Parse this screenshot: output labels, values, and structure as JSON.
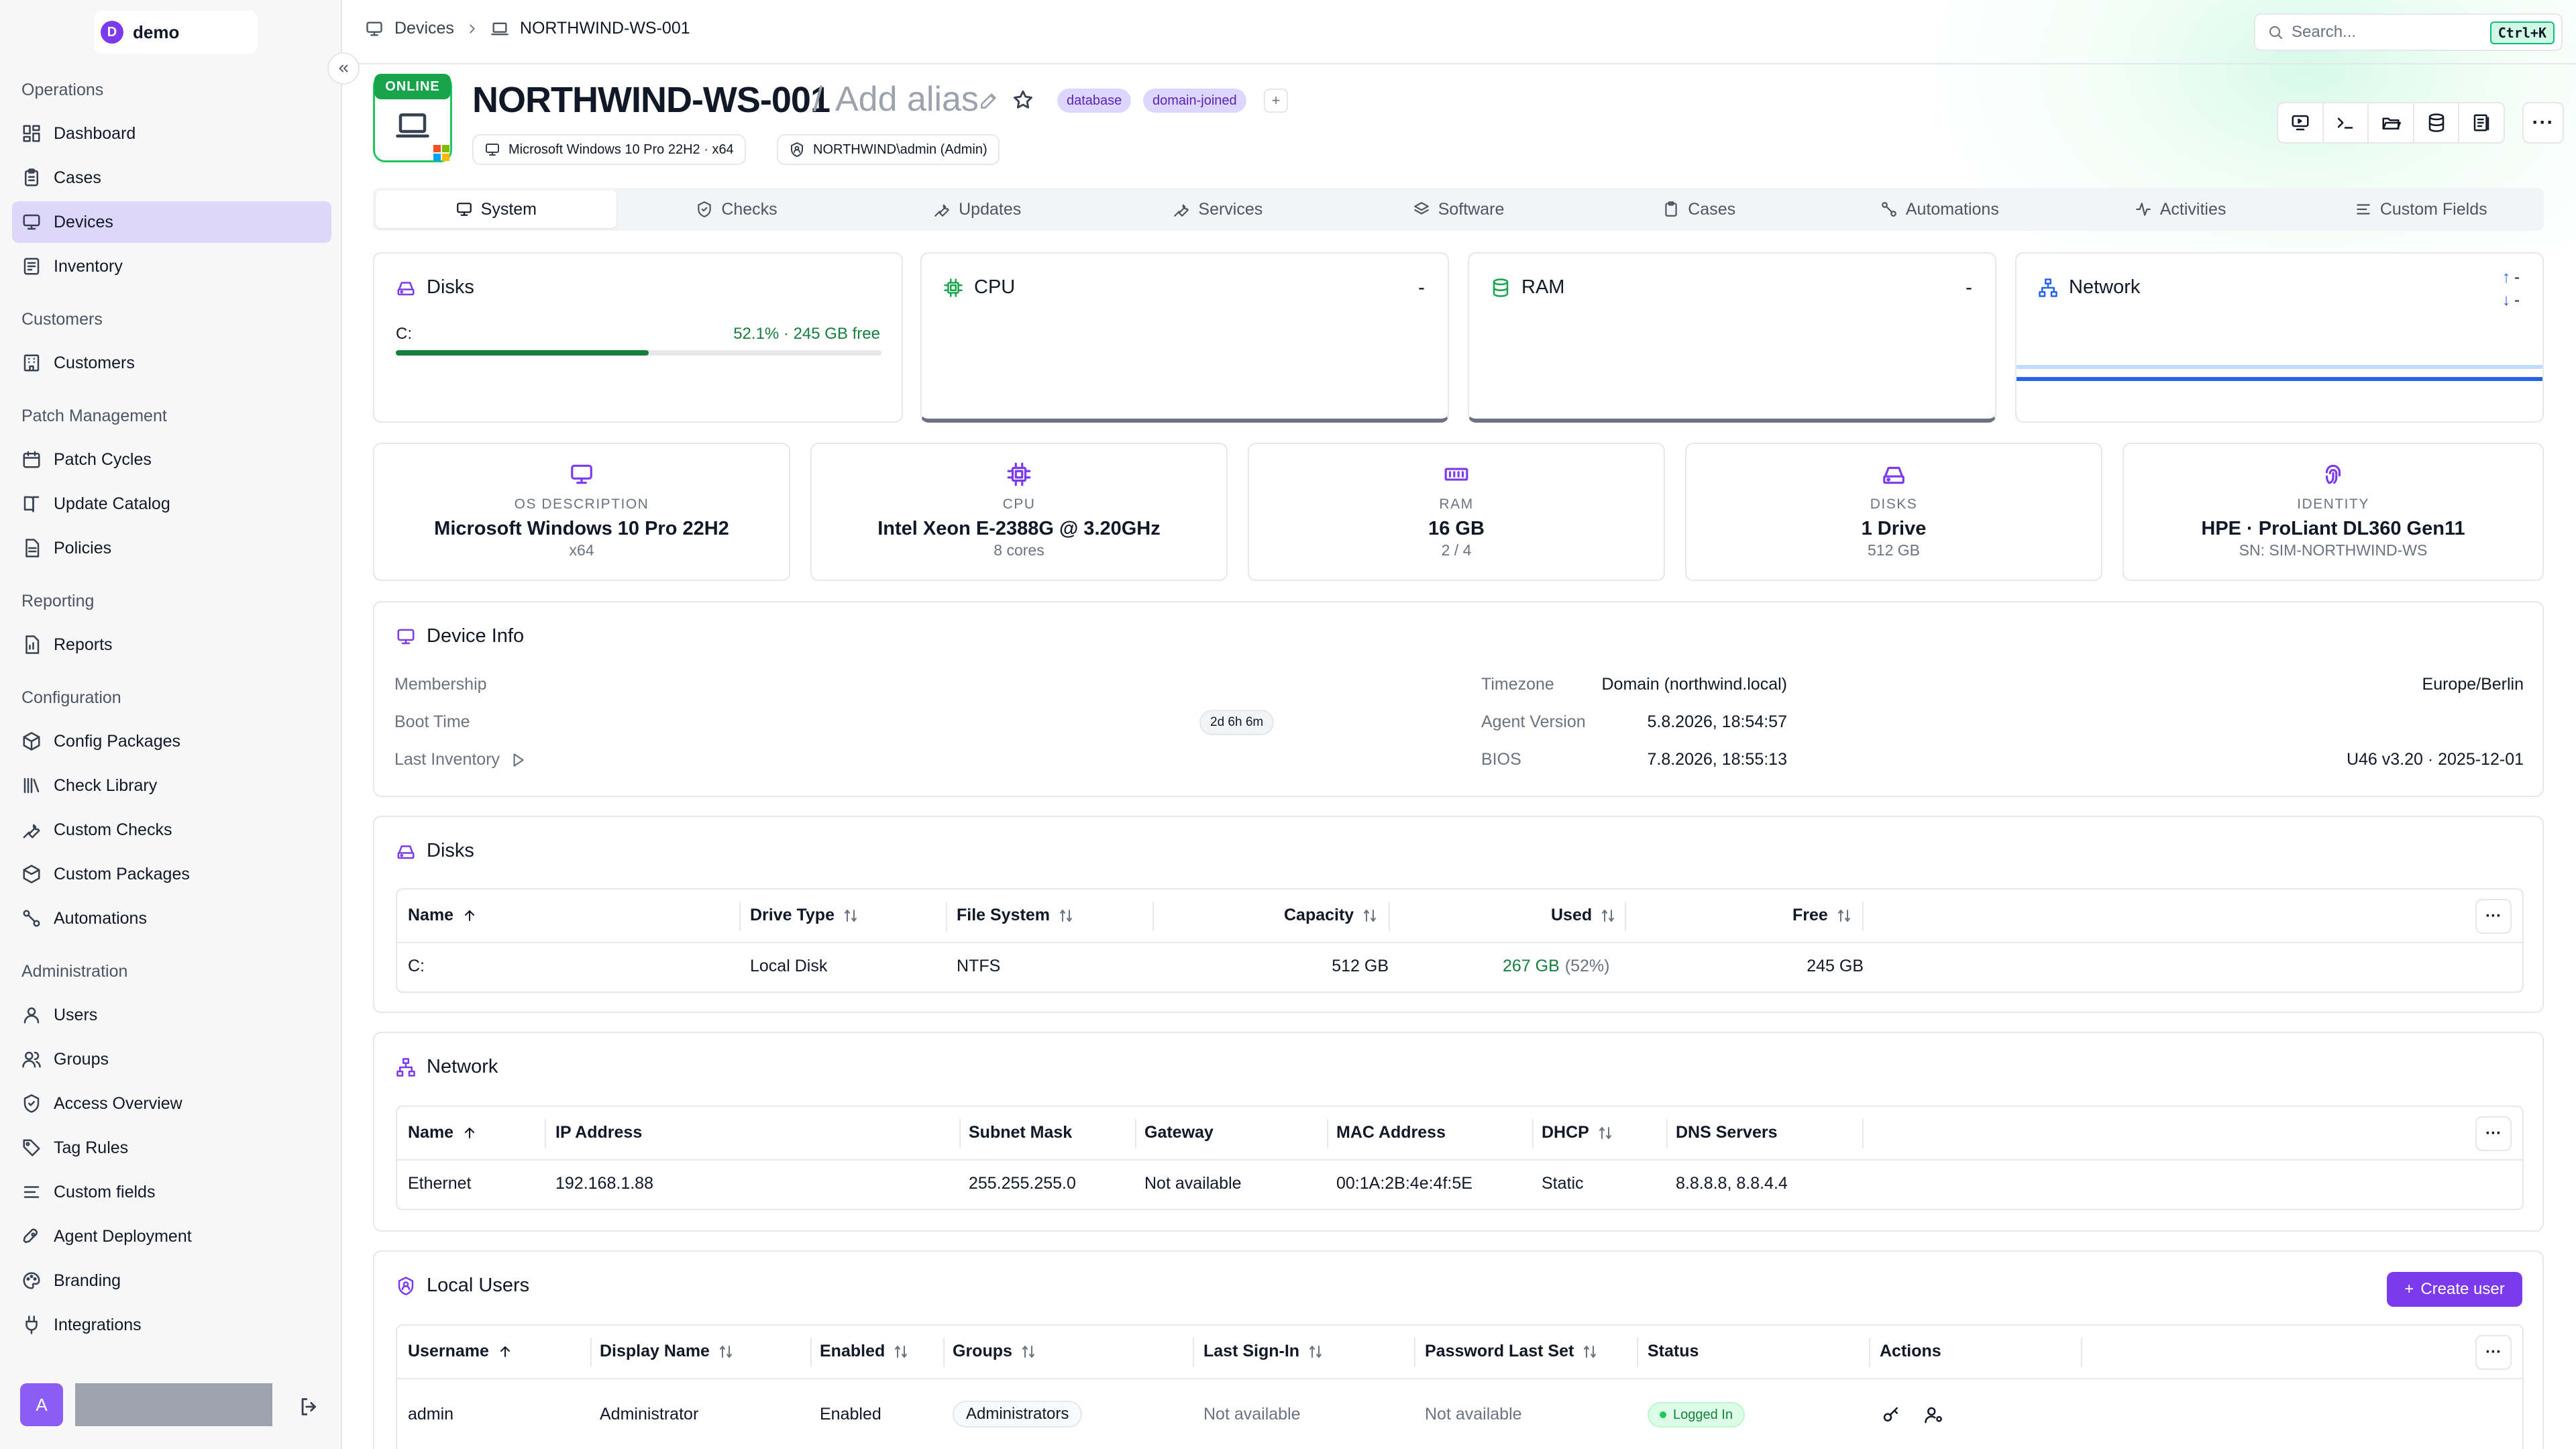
{
  "brand": {
    "initial": "D",
    "name": "demo"
  },
  "sidebar": {
    "sections": [
      {
        "label": "Operations",
        "items": [
          {
            "label": "Dashboard",
            "icon": "dashboard-icon"
          },
          {
            "label": "Cases",
            "icon": "clipboard-icon"
          },
          {
            "label": "Devices",
            "icon": "monitor-icon",
            "active": true
          },
          {
            "label": "Inventory",
            "icon": "inventory-icon"
          }
        ]
      },
      {
        "label": "Customers",
        "items": [
          {
            "label": "Customers",
            "icon": "building-icon"
          }
        ]
      },
      {
        "label": "Patch Management",
        "items": [
          {
            "label": "Patch Cycles",
            "icon": "calendar-icon"
          },
          {
            "label": "Update Catalog",
            "icon": "book-icon"
          },
          {
            "label": "Policies",
            "icon": "document-icon"
          }
        ]
      },
      {
        "label": "Reporting",
        "items": [
          {
            "label": "Reports",
            "icon": "file-chart-icon"
          }
        ]
      },
      {
        "label": "Configuration",
        "items": [
          {
            "label": "Config Packages",
            "icon": "package-icon"
          },
          {
            "label": "Check Library",
            "icon": "library-icon"
          },
          {
            "label": "Custom Checks",
            "icon": "wrench-icon"
          },
          {
            "label": "Custom Packages",
            "icon": "boxes-icon"
          },
          {
            "label": "Automations",
            "icon": "workflow-icon"
          }
        ]
      },
      {
        "label": "Administration",
        "items": [
          {
            "label": "Users",
            "icon": "user-icon"
          },
          {
            "label": "Groups",
            "icon": "users-icon"
          },
          {
            "label": "Access Overview",
            "icon": "shield-icon"
          },
          {
            "label": "Tag Rules",
            "icon": "tag-icon"
          },
          {
            "label": "Custom fields",
            "icon": "list-icon"
          },
          {
            "label": "Agent Deployment",
            "icon": "rocket-icon"
          },
          {
            "label": "Branding",
            "icon": "palette-icon"
          },
          {
            "label": "Integrations",
            "icon": "plug-icon"
          }
        ]
      }
    ],
    "user_initial": "A"
  },
  "breadcrumb": {
    "root": "Devices",
    "current": "NORTHWIND-WS-001"
  },
  "search": {
    "placeholder": "Search...",
    "shortcut": "Ctrl+K"
  },
  "device": {
    "status": "ONLINE",
    "name": "NORTHWIND-WS-001",
    "alias_sep": "/",
    "alias_placeholder": "Add alias",
    "tags": [
      "database",
      "domain-joined"
    ],
    "tag_add": "+",
    "os_chip": "Microsoft Windows 10 Pro 22H2 · x64",
    "user_chip": "NORTHWIND\\admin (Admin)"
  },
  "actions": [
    "remote-desktop-icon",
    "terminal-icon",
    "folder-open-icon",
    "database-icon",
    "registry-icon"
  ],
  "more": "···",
  "tabs": [
    {
      "label": "System",
      "icon": "monitor-icon",
      "active": true
    },
    {
      "label": "Checks",
      "icon": "check-circle-icon"
    },
    {
      "label": "Updates",
      "icon": "wrench-icon"
    },
    {
      "label": "Services",
      "icon": "wrench-icon"
    },
    {
      "label": "Software",
      "icon": "layers-icon"
    },
    {
      "label": "Cases",
      "icon": "clipboard-icon"
    },
    {
      "label": "Automations",
      "icon": "workflow-icon"
    },
    {
      "label": "Activities",
      "icon": "activity-icon"
    },
    {
      "label": "Custom Fields",
      "icon": "list-icon"
    }
  ],
  "metrics": {
    "disks": {
      "title": "Disks",
      "drive": "C:",
      "usage_text": "52.1% · 245 GB free",
      "used_fraction": 0.521
    },
    "cpu": {
      "title": "CPU",
      "value": "-"
    },
    "ram": {
      "title": "RAM",
      "value": "-"
    },
    "network": {
      "title": "Network",
      "up": "-",
      "down": "-"
    }
  },
  "stats": [
    {
      "label": "OS DESCRIPTION",
      "value": "Microsoft Windows 10 Pro 22H2",
      "sub": "x64",
      "icon": "monitor-icon"
    },
    {
      "label": "CPU",
      "value": "Intel Xeon E-2388G @ 3.20GHz",
      "sub": "8 cores",
      "icon": "cpu-icon"
    },
    {
      "label": "RAM",
      "value": "16 GB",
      "sub": "2 / 4",
      "icon": "memory-icon"
    },
    {
      "label": "DISKS",
      "value": "1 Drive",
      "sub": "512 GB",
      "icon": "hard-drive-icon"
    },
    {
      "label": "IDENTITY",
      "value": "HPE · ProLiant DL360 Gen11",
      "sub": "SN: SIM-NORTHWIND-WS",
      "icon": "fingerprint-icon"
    }
  ],
  "device_info": {
    "title": "Device Info",
    "membership_label": "Membership",
    "membership": "Domain (northwind.local)",
    "boot_label": "Boot Time",
    "uptime": "2d 6h 6m",
    "boot": "5.8.2026, 18:54:57",
    "inventory_label": "Last Inventory",
    "inventory": "7.8.2026, 18:55:13",
    "timezone_label": "Timezone",
    "timezone": "Europe/Berlin",
    "agent_label": "Agent Version",
    "agent": "",
    "bios_label": "BIOS",
    "bios": "U46 v3.20 · 2025-12-01"
  },
  "disks_table": {
    "title": "Disks",
    "headers": [
      "Name",
      "Drive Type",
      "File System",
      "Capacity",
      "Used",
      "Free"
    ],
    "row": {
      "name": "C:",
      "type": "Local Disk",
      "fs": "NTFS",
      "capacity": "512 GB",
      "used": "267 GB",
      "used_pct": "(52%)",
      "free": "245 GB"
    }
  },
  "network_table": {
    "title": "Network",
    "headers": [
      "Name",
      "IP Address",
      "Subnet Mask",
      "Gateway",
      "MAC Address",
      "DHCP",
      "DNS Servers"
    ],
    "row": {
      "name": "Ethernet",
      "ip": "192.168.1.88",
      "mask": "255.255.255.0",
      "gateway": "Not available",
      "mac": "00:1A:2B:4e:4f:5E",
      "dhcp": "Static",
      "dns": "8.8.8.8, 8.8.4.4"
    }
  },
  "users_table": {
    "title": "Local Users",
    "create_label": "Create user",
    "headers": [
      "Username",
      "Display Name",
      "Enabled",
      "Groups",
      "Last Sign-In",
      "Password Last Set",
      "Status",
      "Actions"
    ],
    "row": {
      "username": "admin",
      "display": "Administrator",
      "enabled": "Enabled",
      "group": "Administrators",
      "last_signin": "Not available",
      "pw_set": "Not available",
      "status": "Logged In"
    }
  },
  "colors": {
    "accent": "#7c3aed",
    "online": "#16a34a",
    "usage": "#15803d"
  }
}
